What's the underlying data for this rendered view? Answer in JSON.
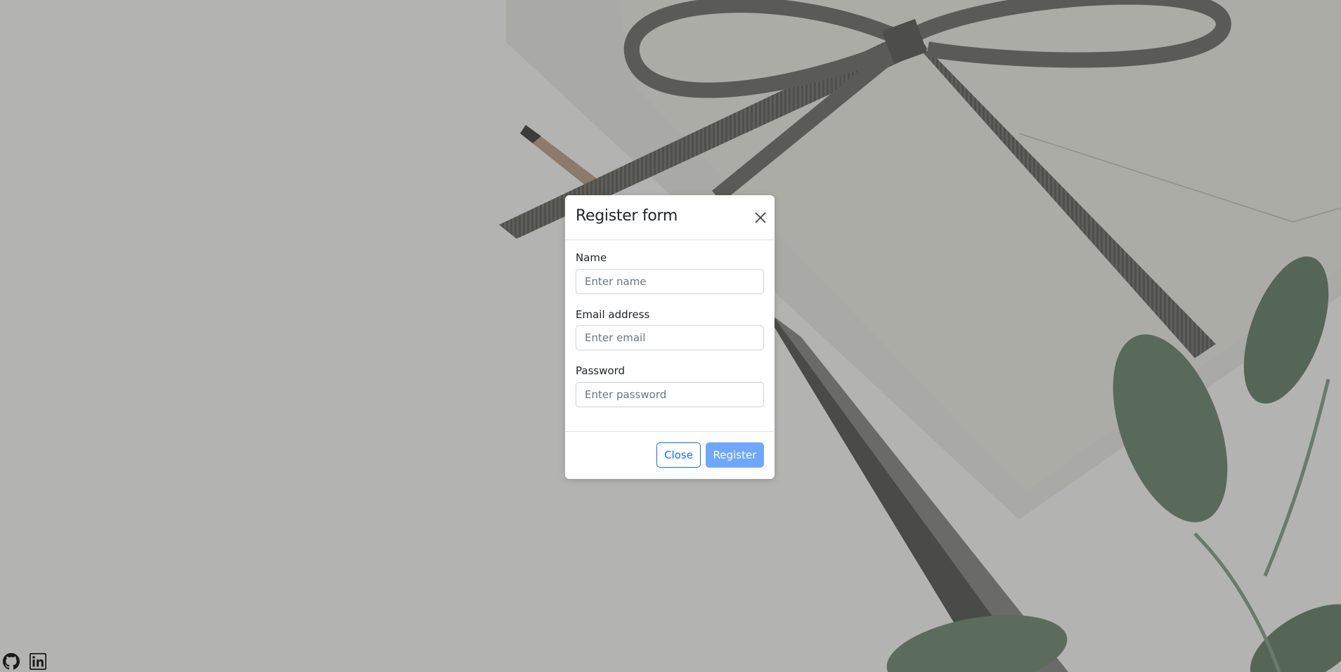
{
  "modal": {
    "title": "Register form",
    "fields": [
      {
        "label": "Name",
        "placeholder": "Enter name",
        "value": ""
      },
      {
        "label": "Email address",
        "placeholder": "Enter email",
        "value": ""
      },
      {
        "label": "Password",
        "placeholder": "Enter password",
        "value": ""
      }
    ],
    "close_label": "Close",
    "register_label": "Register"
  },
  "footer_links": [
    {
      "icon": "github-icon"
    },
    {
      "icon": "linkedin-icon"
    }
  ],
  "colors": {
    "primary": "#0d6efd",
    "primary_disabled": "#6ea8fe",
    "backdrop": "#b4b4b3"
  }
}
